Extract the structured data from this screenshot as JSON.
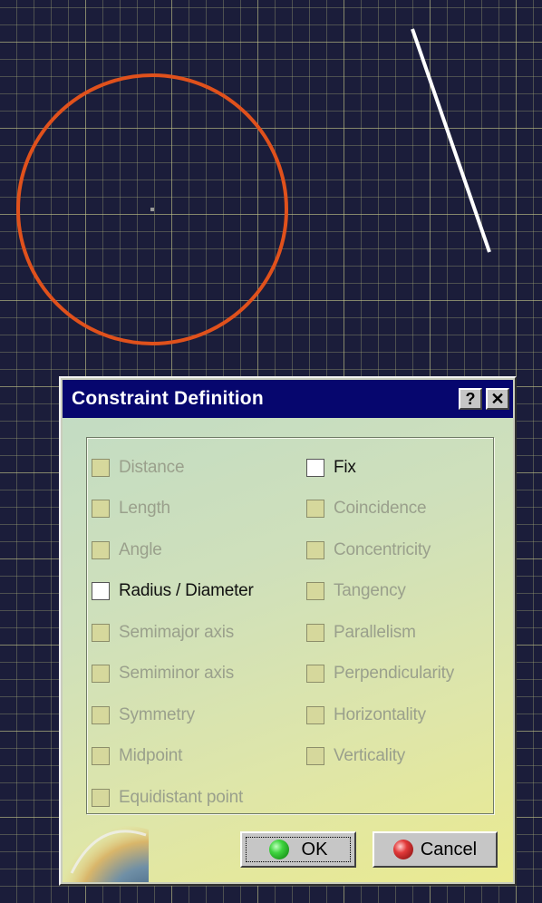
{
  "dialog": {
    "title": "Constraint Definition",
    "help_label": "?",
    "close_label": "✕",
    "left_options": [
      {
        "label": "Distance",
        "checked": false,
        "enabled": false
      },
      {
        "label": "Length",
        "checked": false,
        "enabled": false
      },
      {
        "label": "Angle",
        "checked": false,
        "enabled": false
      },
      {
        "label": "Radius / Diameter",
        "checked": false,
        "enabled": true
      },
      {
        "label": "Semimajor axis",
        "checked": false,
        "enabled": false
      },
      {
        "label": "Semiminor axis",
        "checked": false,
        "enabled": false
      },
      {
        "label": "Symmetry",
        "checked": false,
        "enabled": false
      },
      {
        "label": "Midpoint",
        "checked": false,
        "enabled": false
      },
      {
        "label": "Equidistant point",
        "checked": false,
        "enabled": false
      }
    ],
    "right_options": [
      {
        "label": "Fix",
        "checked": false,
        "enabled": true
      },
      {
        "label": "Coincidence",
        "checked": false,
        "enabled": false
      },
      {
        "label": "Concentricity",
        "checked": false,
        "enabled": false
      },
      {
        "label": "Tangency",
        "checked": false,
        "enabled": false
      },
      {
        "label": "Parallelism",
        "checked": false,
        "enabled": false
      },
      {
        "label": "Perpendicularity",
        "checked": false,
        "enabled": false
      },
      {
        "label": "Horizontality",
        "checked": false,
        "enabled": false
      },
      {
        "label": "Verticality",
        "checked": false,
        "enabled": false
      }
    ],
    "ok_label": "OK",
    "cancel_label": "Cancel"
  },
  "colors": {
    "background": "#1b1d3a",
    "circle": "#e0511c",
    "line": "#ffffff",
    "titlebar": "#06066e"
  },
  "icons": {
    "ok": "green-ball-icon",
    "cancel": "red-ball-icon",
    "logo": "catia-logo"
  }
}
